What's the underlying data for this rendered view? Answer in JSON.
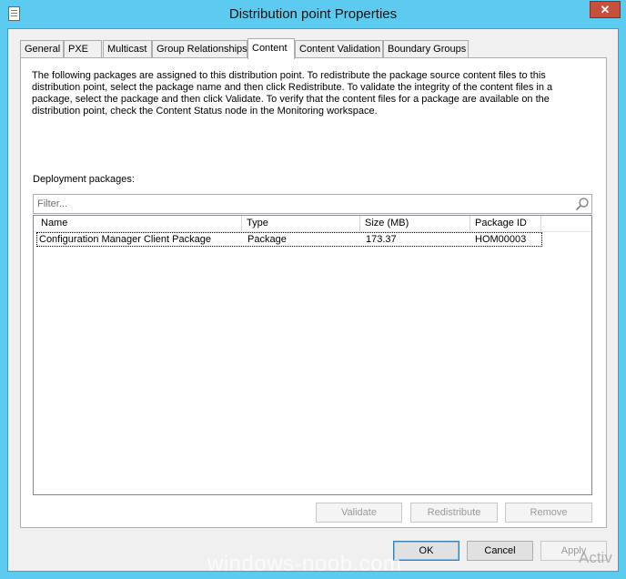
{
  "window": {
    "title": "Distribution point Properties",
    "close_label": "✕"
  },
  "tabs": [
    {
      "label": "General"
    },
    {
      "label": "PXE"
    },
    {
      "label": "Multicast"
    },
    {
      "label": "Group Relationships"
    },
    {
      "label": "Content"
    },
    {
      "label": "Content Validation"
    },
    {
      "label": "Boundary Groups"
    }
  ],
  "content": {
    "description": "The following packages are assigned to this distribution point. To redistribute the package source content files to this distribution point, select the package name and then click Redistribute. To validate the integrity of the content files in a package, select the package and then click Validate. To verify that the content files for a package are available on the distribution point, check the Content Status node in the Monitoring workspace.",
    "packages_label": "Deployment packages:",
    "filter_placeholder": "Filter...",
    "columns": [
      "Name",
      "Type",
      "Size (MB)",
      "Package ID"
    ],
    "rows": [
      {
        "name": "Configuration Manager Client Package",
        "type": "Package",
        "size": "173.37",
        "package_id": "HOM00003"
      }
    ],
    "buttons": {
      "validate": "Validate",
      "redistribute": "Redistribute",
      "remove": "Remove"
    }
  },
  "dialog_buttons": {
    "ok": "OK",
    "cancel": "Cancel",
    "apply": "Apply"
  },
  "overlay": {
    "watermark": "windows-noob.com",
    "activate_text": "Activ"
  },
  "colors": {
    "title_bar": "#5dcbef",
    "close_button": "#c7503d",
    "panel_background": "#f0f0f0"
  }
}
